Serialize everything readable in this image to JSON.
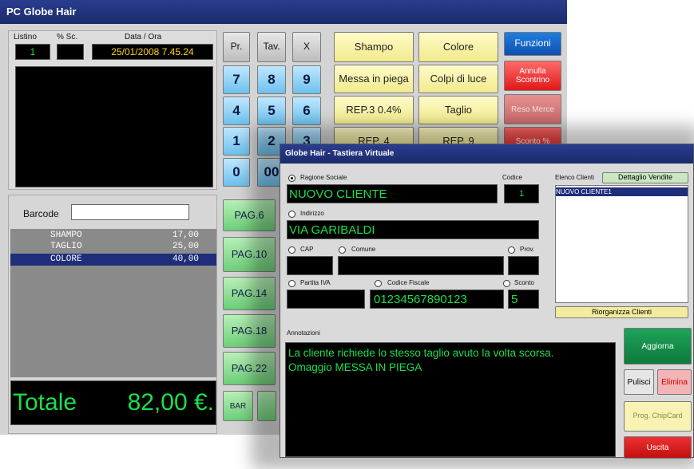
{
  "pos": {
    "title": "PC Globe Hair",
    "hdr_listino": "Listino",
    "hdr_sconto": "% Sc.",
    "hdr_dataora": "Data / Ora",
    "listino_value": "1",
    "sconto_value": "",
    "dataora_value": "25/01/2008 7.45.24",
    "barcode_label": "Barcode",
    "barcode_value": "",
    "items": [
      {
        "name": "SHAMPO",
        "price": "17,00"
      },
      {
        "name": "TAGLIO",
        "price": "25,00"
      },
      {
        "name": "COLORE",
        "price": "40,00"
      }
    ],
    "totale_label": "Totale",
    "totale_value": "82,00 €.",
    "keys": {
      "pr": "Pr.",
      "tav": "Tav.",
      "x": "X",
      "n7": "7",
      "n8": "8",
      "n9": "9",
      "n4": "4",
      "n5": "5",
      "n6": "6",
      "n1": "1",
      "n2": "2",
      "n3": "3",
      "n0": "0",
      "n00": "00"
    },
    "services": [
      "Shampo",
      "Colore",
      "Messa in piega",
      "Colpi di luce",
      "REP.3 0.4%",
      "Taglio",
      "REP. 4",
      "REP. 9"
    ],
    "fn_buttons": {
      "funzioni": "Funzioni",
      "annulla": "Annulla Scontrino",
      "reso": "Reso Merce",
      "sconto": "Sconto %"
    },
    "pay_buttons": [
      "PAG.6",
      "PAG.10",
      "PAG.14",
      "PAG.18",
      "PAG.22"
    ],
    "bar_label": "BAR"
  },
  "vk": {
    "title": "Globe Hair - Tastiera Virtuale",
    "ragione_label": "Ragione Sociale",
    "codice_label": "Codice",
    "ragione_value": "NUOVO CLIENTE",
    "codice_value": "1",
    "indirizzo_label": "Indirizzo",
    "indirizzo_value": "VIA GARIBALDI",
    "cap_label": "CAP",
    "comune_label": "Comune",
    "prov_label": "Prov.",
    "piva_label": "Partita IVA",
    "cf_label": "Codice Fiscale",
    "sconto_label": "Sconto",
    "cf_value": "01234567890123",
    "sconto_value": "5",
    "elenco_label": "Elenco Clienti",
    "dettaglio_btn": "Dettaglio Vendite",
    "clienti": [
      "NUOVO CLIENTE1"
    ],
    "riorganizza_btn": "Riorganizza Clienti",
    "annotazioni_label": "Annotazioni",
    "annotazioni_line1": "La cliente richiede lo stesso taglio avuto la volta scorsa.",
    "annotazioni_line2": "Omaggio MESSA IN PIEGA",
    "aggiorna_btn": "Aggiorna",
    "pulisci_btn": "Pulisci",
    "elimina_btn": "Elimina",
    "chipcard_btn": "Prog. ChipCard",
    "uscita_btn": "Uscita"
  },
  "colors": {
    "screen_green": "#19e04a",
    "title_blue": "#1a2a6c",
    "selection": "#1e2e7a"
  }
}
